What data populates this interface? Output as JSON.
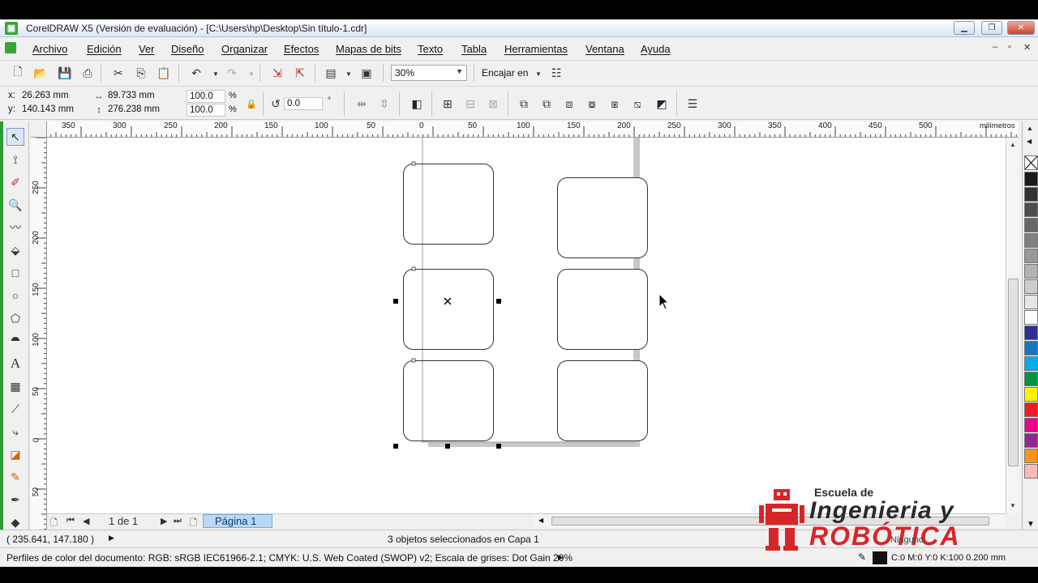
{
  "window": {
    "title": "CorelDRAW X5 (Versión de evaluación) - [C:\\Users\\hp\\Desktop\\Sin título-1.cdr]",
    "buttons": [
      "minimize",
      "restore",
      "close"
    ]
  },
  "menu": {
    "items": [
      "Archivo",
      "Edición",
      "Ver",
      "Diseño",
      "Organizar",
      "Efectos",
      "Mapas de bits",
      "Texto",
      "Tabla",
      "Herramientas",
      "Ventana",
      "Ayuda"
    ]
  },
  "toolbar": {
    "zoom_value": "30%",
    "snap_label": "Encajar en",
    "icons": [
      "new-icon",
      "open-icon",
      "save-icon",
      "print-icon",
      "cut-icon",
      "copy-icon",
      "paste-icon",
      "undo-icon",
      "redo-icon",
      "import-icon",
      "export-icon",
      "app-launcher-icon",
      "welcome-screen-icon",
      "options-icon"
    ]
  },
  "property_bar": {
    "x_label": "x:",
    "x_value": "26.263 mm",
    "y_label": "y:",
    "y_value": "140.143 mm",
    "width_value": "89.733 mm",
    "height_value": "276.238 mm",
    "scale_x": "100.0",
    "scale_y": "100.0",
    "percent": "%",
    "rotation": "0.0",
    "degree": "°"
  },
  "ruler": {
    "unit": "milímetros",
    "h_ticks": [
      "350",
      "300",
      "250",
      "200",
      "150",
      "100",
      "50",
      "0",
      "50",
      "100",
      "150",
      "200",
      "250",
      "300",
      "350",
      "400",
      "450",
      "500"
    ],
    "v_ticks": [
      "250",
      "200",
      "150",
      "100",
      "50",
      "0",
      "50"
    ]
  },
  "palette": {
    "colors": [
      "#1a1a1a",
      "#333333",
      "#4d4d4d",
      "#666666",
      "#808080",
      "#999999",
      "#b3b3b3",
      "#cccccc",
      "#e6e6e6",
      "#ffffff",
      "#2e3192",
      "#1b75bc",
      "#00aeef",
      "#009444",
      "#fff200",
      "#ed1c24",
      "#ec008c",
      "#92278f",
      "#f7941d",
      "#f9b9b6"
    ]
  },
  "pages": {
    "first_icon": "add-page-icon",
    "counter": "1 de 1",
    "tab": "Página 1"
  },
  "status": {
    "coords": "( 235.641, 147.180 )",
    "selection": "3 objetos seleccionados en Capa 1",
    "color_profile": "Perfiles de color del documento: RGB: sRGB IEC61966-2.1; CMYK: U.S. Web Coated (SWOP) v2; Escala de grises: Dot Gain 20%",
    "fill": "Ninguno",
    "outline": "C:0 M:0 Y:0 K:100  0.200 mm"
  },
  "logo": {
    "line1": "Escuela de",
    "line2": "Ingenieria y",
    "line3": "ROBÓTICA"
  }
}
